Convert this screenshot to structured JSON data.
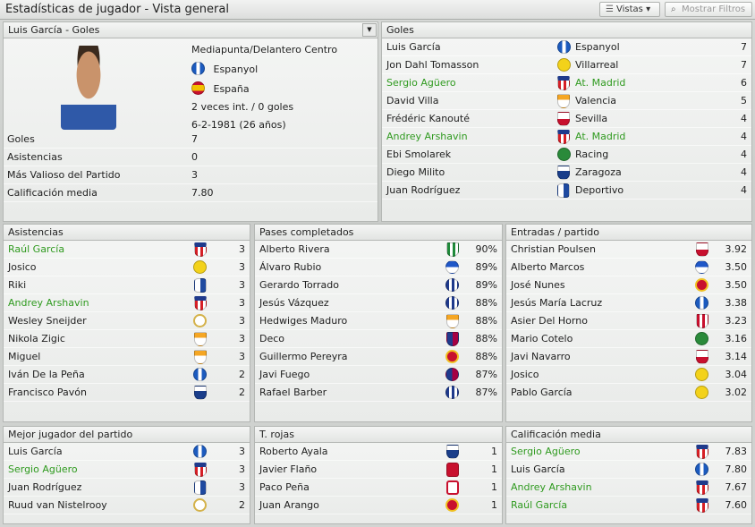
{
  "window": {
    "title": "Estadísticas de jugador - Vista general",
    "vistas_label": "Vistas",
    "filtros_label": "Mostrar Filtros"
  },
  "player": {
    "heading": "Luis García - Goles",
    "position": "Mediapunta/Delantero Centro",
    "club": "Espanyol",
    "nation": "España",
    "caps": "2 veces int. / 0 goles",
    "dob": "6-2-1981 (26 años)",
    "stats": [
      {
        "label": "Goles",
        "value": "7"
      },
      {
        "label": "Asistencias",
        "value": "0"
      },
      {
        "label": "Más Valioso del Partido",
        "value": "3"
      },
      {
        "label": "Calificación media",
        "value": "7.80"
      }
    ]
  },
  "goles": {
    "heading": "Goles",
    "rows": [
      {
        "name": "Luis García",
        "club": "Espanyol",
        "crest": "c-espanyol",
        "value": "7",
        "highlight": false
      },
      {
        "name": "Jon Dahl Tomasson",
        "club": "Villarreal",
        "crest": "c-villarreal",
        "value": "7",
        "highlight": false
      },
      {
        "name": "Sergio Agüero",
        "club": "At. Madrid",
        "crest": "c-atm",
        "value": "6",
        "highlight": true
      },
      {
        "name": "David Villa",
        "club": "Valencia",
        "crest": "c-valencia",
        "value": "5",
        "highlight": false
      },
      {
        "name": "Frédéric Kanouté",
        "club": "Sevilla",
        "crest": "c-sevilla",
        "value": "4",
        "highlight": false
      },
      {
        "name": "Andrey Arshavin",
        "club": "At. Madrid",
        "crest": "c-atm",
        "value": "4",
        "highlight": true
      },
      {
        "name": "Ebi Smolarek",
        "club": "Racing",
        "crest": "c-racing",
        "value": "4",
        "highlight": false
      },
      {
        "name": "Diego Milito",
        "club": "Zaragoza",
        "crest": "c-zaragoza",
        "value": "4",
        "highlight": false
      },
      {
        "name": "Juan Rodríguez",
        "club": "Deportivo",
        "crest": "c-depor",
        "value": "4",
        "highlight": false
      }
    ]
  },
  "asistencias": {
    "heading": "Asistencias",
    "rows": [
      {
        "name": "Raúl García",
        "crest": "c-atm",
        "value": "3",
        "highlight": true
      },
      {
        "name": "Josico",
        "crest": "c-villarreal",
        "value": "3",
        "highlight": false
      },
      {
        "name": "Riki",
        "crest": "c-depor",
        "value": "3",
        "highlight": false
      },
      {
        "name": "Andrey Arshavin",
        "crest": "c-atm",
        "value": "3",
        "highlight": true
      },
      {
        "name": "Wesley Sneijder",
        "crest": "c-madrid",
        "value": "3",
        "highlight": false
      },
      {
        "name": "Nikola Zigic",
        "crest": "c-valencia",
        "value": "3",
        "highlight": false
      },
      {
        "name": "Miguel",
        "crest": "c-valencia",
        "value": "3",
        "highlight": false
      },
      {
        "name": "Iván De la Peña",
        "crest": "c-espanyol",
        "value": "2",
        "highlight": false
      },
      {
        "name": "Francisco Pavón",
        "crest": "c-zaragoza",
        "value": "2",
        "highlight": false
      }
    ]
  },
  "pases": {
    "heading": "Pases completados",
    "rows": [
      {
        "name": "Alberto Rivera",
        "crest": "c-betis",
        "value": "90%",
        "highlight": false
      },
      {
        "name": "Álvaro Rubio",
        "crest": "c-getafe",
        "value": "89%",
        "highlight": false
      },
      {
        "name": "Gerardo Torrado",
        "crest": "c-recre",
        "value": "89%",
        "highlight": false
      },
      {
        "name": "Jesús Vázquez",
        "crest": "c-recre",
        "value": "88%",
        "highlight": false
      },
      {
        "name": "Hedwiges Maduro",
        "crest": "c-valencia",
        "value": "88%",
        "highlight": false
      },
      {
        "name": "Deco",
        "crest": "c-barca",
        "value": "88%",
        "highlight": false
      },
      {
        "name": "Guillermo Pereyra",
        "crest": "c-mallorca",
        "value": "88%",
        "highlight": false
      },
      {
        "name": "Javi Fuego",
        "crest": "c-levante",
        "value": "87%",
        "highlight": false
      },
      {
        "name": "Rafael Barber",
        "crest": "c-recre",
        "value": "87%",
        "highlight": false
      }
    ]
  },
  "entradas": {
    "heading": "Entradas / partido",
    "rows": [
      {
        "name": "Christian Poulsen",
        "crest": "c-sevilla",
        "value": "3.92",
        "highlight": false
      },
      {
        "name": "Alberto Marcos",
        "crest": "c-getafe",
        "value": "3.50",
        "highlight": false
      },
      {
        "name": "José Nunes",
        "crest": "c-mallorca",
        "value": "3.50",
        "highlight": false
      },
      {
        "name": "Jesús María Lacruz",
        "crest": "c-espanyol",
        "value": "3.38",
        "highlight": false
      },
      {
        "name": "Asier Del Horno",
        "crest": "c-athletic",
        "value": "3.23",
        "highlight": false
      },
      {
        "name": "Mario Cotelo",
        "crest": "c-racing",
        "value": "3.16",
        "highlight": false
      },
      {
        "name": "Javi Navarro",
        "crest": "c-sevilla",
        "value": "3.14",
        "highlight": false
      },
      {
        "name": "Josico",
        "crest": "c-villarreal",
        "value": "3.04",
        "highlight": false
      },
      {
        "name": "Pablo García",
        "crest": "c-villarreal",
        "value": "3.02",
        "highlight": false
      }
    ]
  },
  "mejor": {
    "heading": "Mejor jugador del partido",
    "rows": [
      {
        "name": "Luis García",
        "crest": "c-espanyol",
        "value": "3",
        "highlight": false
      },
      {
        "name": "Sergio Agüero",
        "crest": "c-atm",
        "value": "3",
        "highlight": true
      },
      {
        "name": "Juan Rodríguez",
        "crest": "c-depor",
        "value": "3",
        "highlight": false
      },
      {
        "name": "Ruud van Nistelrooy",
        "crest": "c-madrid",
        "value": "2",
        "highlight": false
      }
    ]
  },
  "rojas": {
    "heading": "T. rojas",
    "rows": [
      {
        "name": "Roberto Ayala",
        "crest": "c-zaragoza",
        "value": "1",
        "highlight": false
      },
      {
        "name": "Javier Flaño",
        "crest": "c-osasuna",
        "value": "1",
        "highlight": false
      },
      {
        "name": "Paco Peña",
        "crest": "c-murcia",
        "value": "1",
        "highlight": false
      },
      {
        "name": "Juan Arango",
        "crest": "c-mallorca",
        "value": "1",
        "highlight": false
      }
    ]
  },
  "calificacion": {
    "heading": "Calificación media",
    "rows": [
      {
        "name": "Sergio Agüero",
        "crest": "c-atm",
        "value": "7.83",
        "highlight": true
      },
      {
        "name": "Luis García",
        "crest": "c-espanyol",
        "value": "7.80",
        "highlight": false
      },
      {
        "name": "Andrey Arshavin",
        "crest": "c-atm",
        "value": "7.67",
        "highlight": true
      },
      {
        "name": "Raúl García",
        "crest": "c-atm",
        "value": "7.60",
        "highlight": true
      }
    ]
  },
  "colors": {
    "highlight": "#2f9a1f",
    "text": "#1e1e1e",
    "panel_border": "#b4b7b4"
  }
}
